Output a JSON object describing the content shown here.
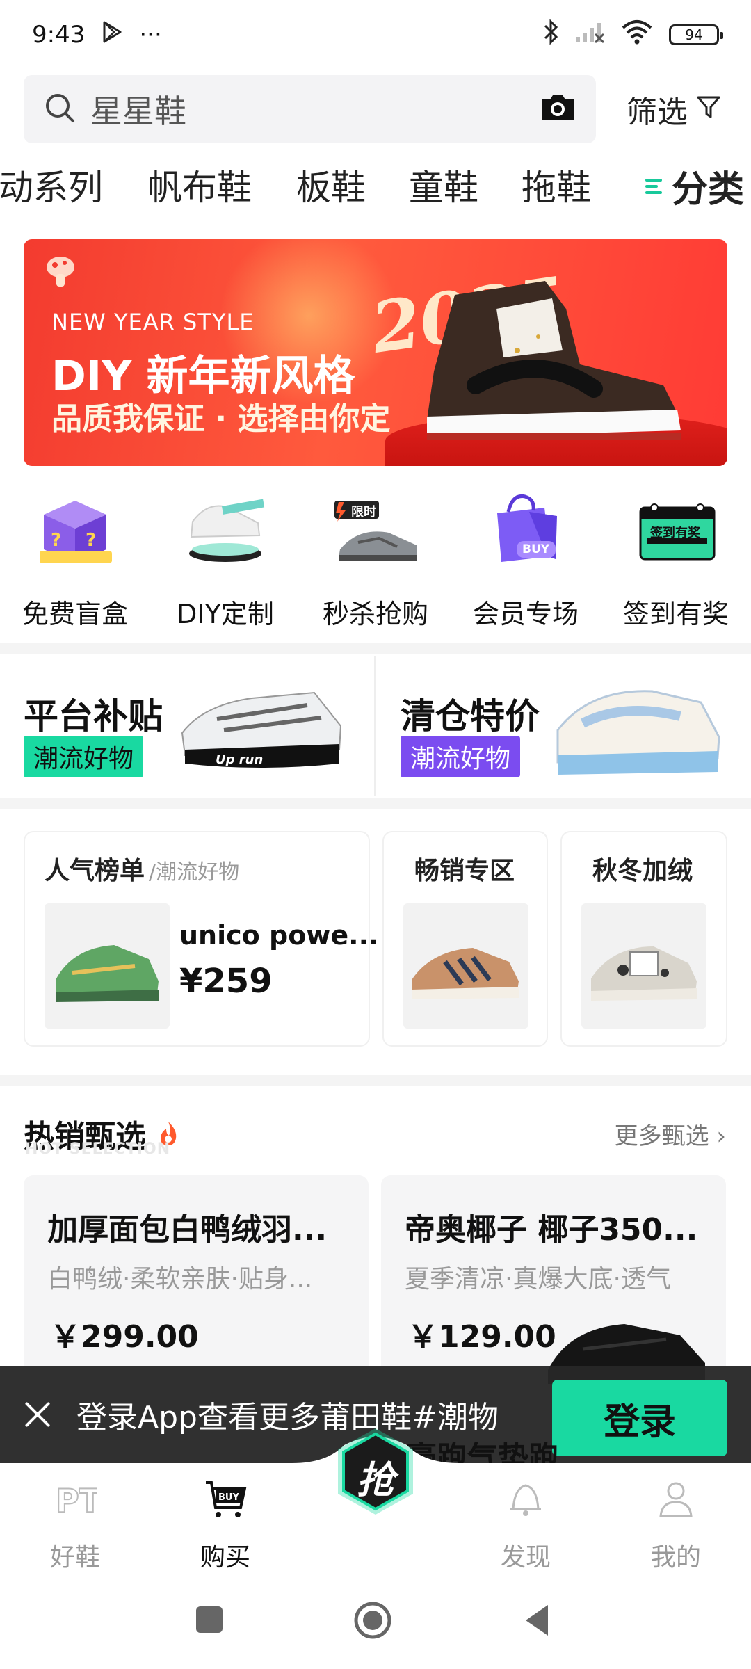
{
  "status_bar": {
    "time": "9:43",
    "more": "···",
    "battery": "94"
  },
  "search": {
    "query": "星星鞋",
    "filter_label": "筛选"
  },
  "categories": [
    "动系列",
    "帆布鞋",
    "板鞋",
    "童鞋",
    "拖鞋"
  ],
  "categories_more": "分类",
  "banner": {
    "en_title": "NEW YEAR STYLE",
    "title": "DIY 新年新风格",
    "subtitle": "品质我保证 · 选择由你定",
    "year": "2025"
  },
  "icon_grid": [
    {
      "label": "免费盲盒",
      "icon": "blind-box-icon"
    },
    {
      "label": "DIY定制",
      "icon": "diy-sneaker-icon"
    },
    {
      "label": "秒杀抢购",
      "icon": "flash-sale-icon",
      "badge": "限时"
    },
    {
      "label": "会员专场",
      "icon": "shopping-bag-icon",
      "badge": "BUY"
    },
    {
      "label": "签到有奖",
      "icon": "calendar-icon",
      "badge": "签到有奖"
    }
  ],
  "promos": [
    {
      "title": "平台补贴",
      "tag": "潮流好物",
      "tag_color": "#19d9a1"
    },
    {
      "title": "清仓特价",
      "tag": "潮流好物",
      "tag_color": "#7b4cf0"
    }
  ],
  "cards": {
    "popular": {
      "title": "人气榜单",
      "subtitle": "/潮流好物",
      "product": "unico powe...",
      "price": "¥259"
    },
    "bestseller": {
      "title": "畅销专区"
    },
    "autumn": {
      "title": "秋冬加绒"
    }
  },
  "hot": {
    "title": "热销甄选",
    "subtitle": "HOT SELECTION",
    "more": "更多甄选",
    "products": [
      {
        "name": "加厚面包白鸭绒羽...",
        "desc": "白鸭绒·柔软亲肤·贴身...",
        "price": "￥299.00"
      },
      {
        "name": "帝奥椰子 椰子350...",
        "desc": "夏季清凉·真爆大底·透气",
        "price": "￥129.00"
      }
    ],
    "partial_title": "豪跑气垫跑"
  },
  "login_bar": {
    "message": "登录App查看更多莆田鞋#潮物",
    "button": "登录"
  },
  "bottom_nav": [
    {
      "label": "好鞋",
      "icon": "pt-logo-icon"
    },
    {
      "label": "购买",
      "icon": "buy-cart-icon",
      "active": true
    },
    {
      "label": "抢",
      "icon": "grab-center-icon"
    },
    {
      "label": "发现",
      "icon": "bell-icon"
    },
    {
      "label": "我的",
      "icon": "profile-icon"
    }
  ],
  "colors": {
    "accent": "#19d9a1",
    "purple": "#7b4cf0",
    "banner_red": "#f33b2f"
  }
}
